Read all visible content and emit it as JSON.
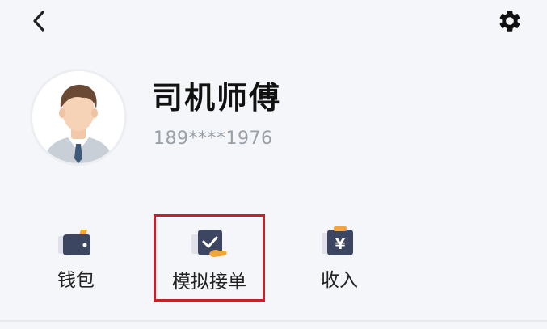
{
  "header": {
    "back_icon": "chevron-left-icon",
    "settings_icon": "gear-icon"
  },
  "profile": {
    "name": "司机师傅",
    "phone": "189****1976",
    "avatar_icon": "driver-avatar-icon"
  },
  "actions": [
    {
      "label": "钱包",
      "icon": "wallet-icon"
    },
    {
      "label": "模拟接单",
      "icon": "simulate-order-icon",
      "highlighted": true
    },
    {
      "label": "收入",
      "icon": "income-icon"
    }
  ],
  "colors": {
    "background": "#f5f6fa",
    "icon_dark": "#3d4660",
    "icon_accent": "#f2a63a",
    "highlight_border": "#c8202a"
  }
}
